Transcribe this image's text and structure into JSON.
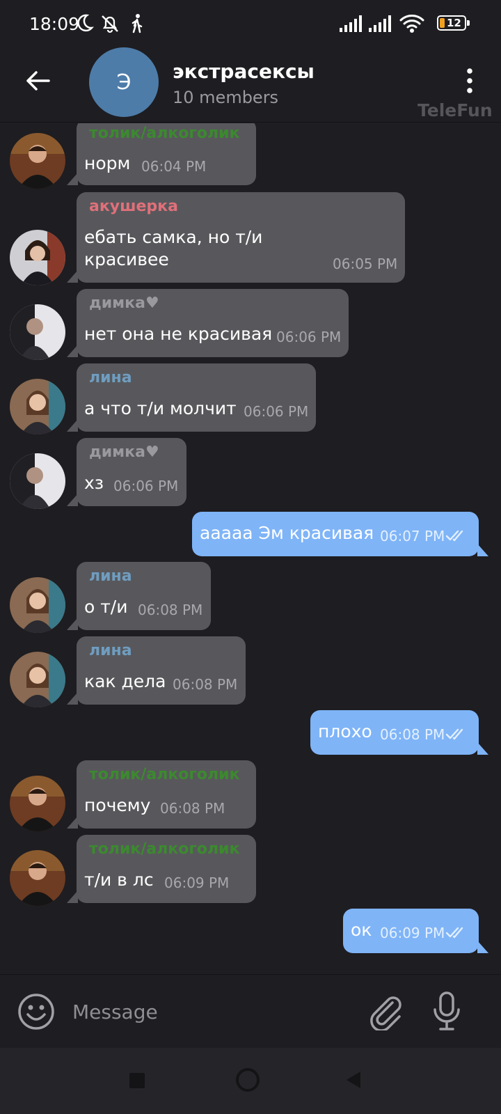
{
  "status_bar": {
    "time": "18:09",
    "battery_level": "12",
    "icons": [
      "moon-icon",
      "bell-off-icon",
      "walking-icon",
      "signal-icon",
      "signal-icon",
      "wifi-icon",
      "battery-icon"
    ]
  },
  "header": {
    "avatar_letter": "Э",
    "title": "экстрасексы",
    "subtitle": "10 members",
    "watermark": "TeleFun"
  },
  "colors": {
    "background": "#1e1d21",
    "incoming_bubble": "#58585c",
    "outgoing_bubble": "#7fb4f7",
    "group_avatar": "#4d7ca9",
    "sender_tolik": "#3b8a2e",
    "sender_akusherka": "#e0707a",
    "sender_dimka": "#9a9a9e",
    "sender_lina": "#6f9dc0"
  },
  "messages": [
    {
      "direction": "in",
      "sender": "толик/алкоголик",
      "text": "норм",
      "time": "06:04 PM"
    },
    {
      "direction": "in",
      "sender": "акушерка",
      "text_line1": "ебать самка, но т/и",
      "text_line2": "красивее",
      "time": "06:05 PM"
    },
    {
      "direction": "in",
      "sender": "димка♥",
      "text": "нет она не красивая",
      "time": "06:06 PM"
    },
    {
      "direction": "in",
      "sender": "лина",
      "text": "а что т/и молчит",
      "time": "06:06 PM"
    },
    {
      "direction": "in",
      "sender": "димка♥",
      "text": "хз",
      "time": "06:06 PM"
    },
    {
      "direction": "out",
      "text": "ааааа Эм красивая",
      "time": "06:07 PM",
      "status": "read"
    },
    {
      "direction": "in",
      "sender": "лина",
      "text": "о т/и",
      "time": "06:08 PM"
    },
    {
      "direction": "in",
      "sender": "лина",
      "text": "как дела",
      "time": "06:08 PM"
    },
    {
      "direction": "out",
      "text": "плохо",
      "time": "06:08 PM",
      "status": "read"
    },
    {
      "direction": "in",
      "sender": "толик/алкоголик",
      "text": "почему",
      "time": "06:08 PM"
    },
    {
      "direction": "in",
      "sender": "толик/алкоголик",
      "text": "т/и в лс",
      "time": "06:09 PM"
    },
    {
      "direction": "out",
      "text": "ок",
      "time": "06:09 PM",
      "status": "read"
    }
  ],
  "input": {
    "placeholder": "Message"
  }
}
